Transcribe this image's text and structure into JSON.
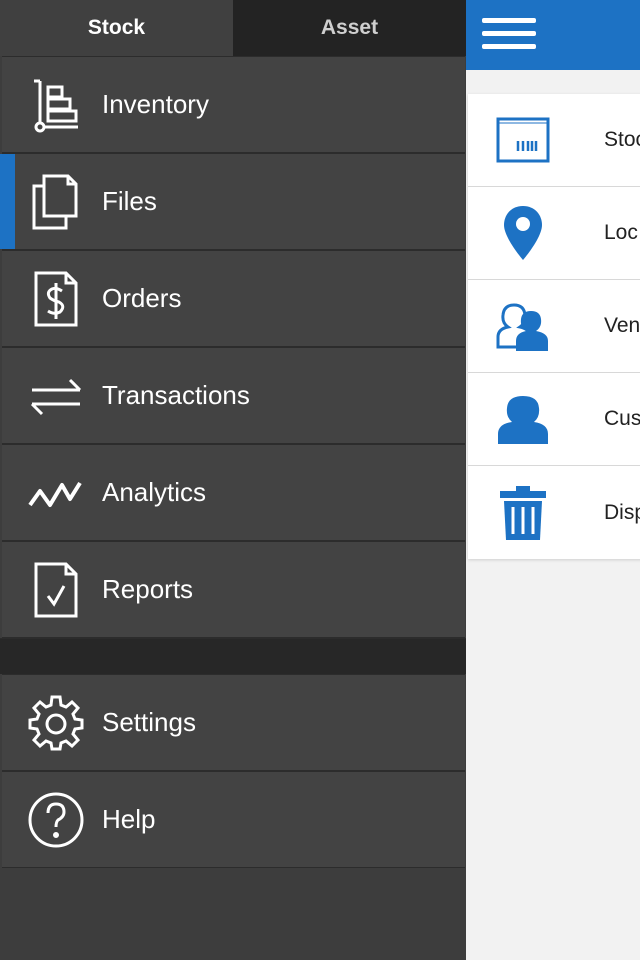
{
  "tabs": [
    {
      "label": "Stock",
      "active": true
    },
    {
      "label": "Asset",
      "active": false
    }
  ],
  "menu": {
    "primary": [
      {
        "label": "Inventory",
        "icon": "inventory-cart-icon"
      },
      {
        "label": "Files",
        "icon": "files-icon",
        "selected": true
      },
      {
        "label": "Orders",
        "icon": "dollar-document-icon"
      },
      {
        "label": "Transactions",
        "icon": "arrows-exchange-icon"
      },
      {
        "label": "Analytics",
        "icon": "zigzag-line-icon"
      },
      {
        "label": "Reports",
        "icon": "check-document-icon"
      }
    ],
    "secondary": [
      {
        "label": "Settings",
        "icon": "gear-icon"
      },
      {
        "label": "Help",
        "icon": "question-circle-icon"
      }
    ]
  },
  "main": {
    "list": [
      {
        "label": "Stoc",
        "icon": "barcode-box-icon"
      },
      {
        "label": "Loc",
        "icon": "location-pin-icon"
      },
      {
        "label": "Ven",
        "icon": "vendor-people-icon"
      },
      {
        "label": "Cus",
        "icon": "customer-person-icon"
      },
      {
        "label": "Disp",
        "icon": "trash-icon"
      }
    ]
  },
  "colors": {
    "accent": "#1d72c4",
    "drawer_bg": "#434343",
    "tab_inactive": "#232323"
  }
}
